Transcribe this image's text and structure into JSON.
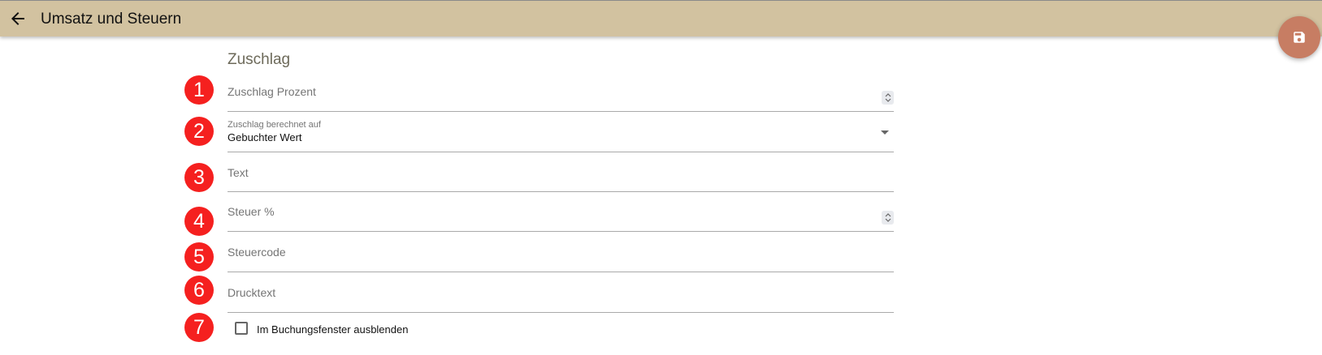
{
  "header": {
    "title": "Umsatz und Steuern",
    "back_icon": "arrow-left-icon",
    "background": "#d2c2a0"
  },
  "fab": {
    "icon": "save-icon",
    "color": "#c77d63"
  },
  "section": {
    "title": "Zuschlag"
  },
  "badges": [
    "1",
    "2",
    "3",
    "4",
    "5",
    "6",
    "7"
  ],
  "badge_color": "#f5201f",
  "fields": {
    "zuschlag_prozent": {
      "label": "Zuschlag Prozent",
      "value": "",
      "type": "number"
    },
    "berechnet_auf": {
      "label": "Zuschlag berechnet auf",
      "value": "Gebuchter Wert",
      "type": "select"
    },
    "text": {
      "label": "Text",
      "value": ""
    },
    "steuer": {
      "label": "Steuer %",
      "value": "",
      "type": "number"
    },
    "steuercode": {
      "label": "Steuercode",
      "value": ""
    },
    "drucktext": {
      "label": "Drucktext",
      "value": ""
    }
  },
  "checkbox": {
    "label": "Im Buchungsfenster ausblenden",
    "checked": false
  }
}
